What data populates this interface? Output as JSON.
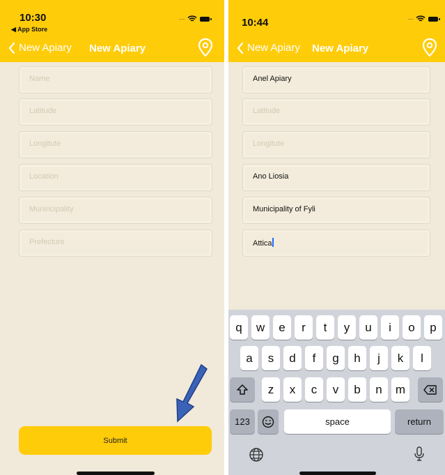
{
  "left": {
    "status": {
      "time": "10:30",
      "back_app": "◀ App Store"
    },
    "nav": {
      "back_label": "New Apiary",
      "title": "New Apiary"
    },
    "fields": [
      {
        "name": "name",
        "value": "",
        "placeholder": "Name"
      },
      {
        "name": "latitude",
        "value": "",
        "placeholder": "Latitude"
      },
      {
        "name": "longitude",
        "value": "",
        "placeholder": "Longitute"
      },
      {
        "name": "location",
        "value": "",
        "placeholder": "Location"
      },
      {
        "name": "municipality",
        "value": "",
        "placeholder": "Munincipality"
      },
      {
        "name": "prefecture",
        "value": "",
        "placeholder": "Prefecture"
      }
    ],
    "submit_label": "Submit"
  },
  "right": {
    "status": {
      "time": "10:44"
    },
    "nav": {
      "back_label": "New Apiary",
      "title": "New Apiary"
    },
    "fields": [
      {
        "name": "name",
        "value": "Anel Apiary",
        "placeholder": "Name"
      },
      {
        "name": "latitude",
        "value": "",
        "placeholder": "Latitude"
      },
      {
        "name": "longitude",
        "value": "",
        "placeholder": "Longitute"
      },
      {
        "name": "location",
        "value": "Ano Liosia",
        "placeholder": "Location"
      },
      {
        "name": "municipality",
        "value": "Municipality of Fyli",
        "placeholder": "Munincipality"
      },
      {
        "name": "prefecture",
        "value": "Attica",
        "placeholder": "Prefecture"
      }
    ],
    "keyboard": {
      "row1": [
        "q",
        "w",
        "e",
        "r",
        "t",
        "y",
        "u",
        "i",
        "o",
        "p"
      ],
      "row2": [
        "a",
        "s",
        "d",
        "f",
        "g",
        "h",
        "j",
        "k",
        "l"
      ],
      "row3": [
        "z",
        "x",
        "c",
        "v",
        "b",
        "n",
        "m"
      ],
      "numbers_key": "123",
      "space_key": "space",
      "return_key": "return"
    }
  },
  "colors": {
    "accent": "#ffcc0a",
    "background": "#f1e9d9",
    "arrow": "#3a63b8"
  },
  "icons": [
    "location-pin-icon",
    "chevron-left-icon",
    "wifi-icon",
    "battery-icon",
    "shift-icon",
    "delete-icon",
    "emoji-icon",
    "globe-icon",
    "microphone-icon",
    "annotation-arrow-icon"
  ]
}
